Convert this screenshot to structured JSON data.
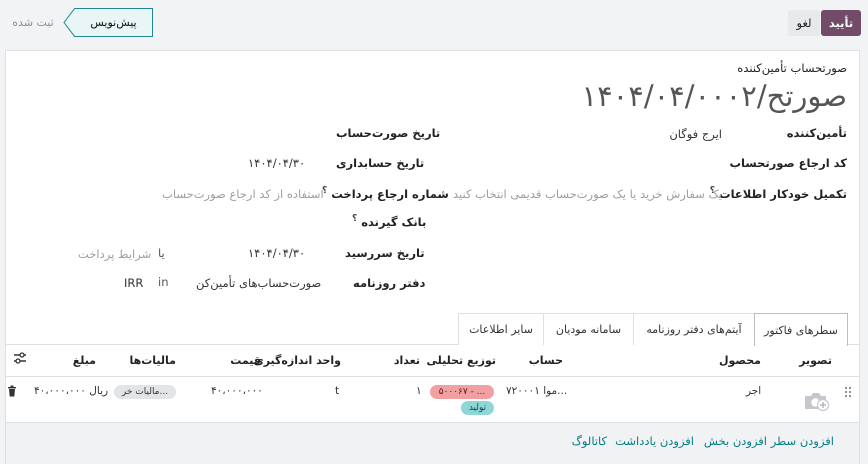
{
  "header": {
    "confirm_label": "تأیید",
    "cancel_label": "لغو",
    "status_current": "پیش‌نویس",
    "status_next": "ثبت شده"
  },
  "form": {
    "doc_type": "صورتحساب تأمین‌کننده",
    "title": "صورتح/۱۴۰۴/۰۴/۰۰۰۲",
    "vendor_label": "تأمین‌کننده",
    "vendor_value": "ایرج فوگان",
    "bill_ref_label": "کد ارجاع صورتحساب",
    "autocomplete_label": "تکمیل خودکار اطلاعات",
    "autocomplete_placeholder": "یک سفارش خرید یا یک صورت‌حساب قدیمی انتخاب کنید",
    "bill_date_label": "تاریخ صورت‌حساب",
    "accounting_date_label": "تاریخ حسابداری",
    "accounting_date_value": "۱۴۰۴/۰۴/۳۰",
    "payment_ref_label": "شماره ارجاع پرداخت",
    "payment_ref_placeholder": "استفاده از کد ارجاع صورت‌حساب",
    "bank_label": "بانک گیرنده",
    "due_date_label": "تاریخ سررسید",
    "due_date_value": "۱۴۰۴/۰۴/۳۰",
    "or_label": "یا",
    "payment_terms_placeholder": "شرایط پرداخت",
    "journal_label": "دفتر روزنامه",
    "journal_value": "صورت‌حساب‌های تأمین‌کن",
    "in_label": "in",
    "currency_value": "IRR",
    "help_mark": "؟"
  },
  "tabs": [
    {
      "label": "سطرهای فاکتور"
    },
    {
      "label": "آیتم‌های دفتر روزنامه"
    },
    {
      "label": "سامانه مودیان"
    },
    {
      "label": "سایر اطلاعات"
    }
  ],
  "table": {
    "columns": {
      "image": "تصویر",
      "product": "محصول",
      "account": "حساب",
      "analytic": "توزیع تحلیلی",
      "quantity": "تعداد",
      "uom": "واحد اندازه‌گیری",
      "price": "قیمت",
      "taxes": "مالیات‌ها",
      "amount": "مبلغ"
    },
    "rows": [
      {
        "product": "اجر",
        "account": "۷۲۰۰۰۱ موا...",
        "analytic_tag": "۵۰۰۰۶۷ - ...",
        "analytic_tag2": "تولید",
        "quantity": "۱",
        "uom": "t",
        "price": "۴۰،۰۰۰،۰۰۰",
        "taxes": "مالیات خر...",
        "amount": "۴۰،۰۰۰،۰۰۰ ریال"
      }
    ]
  },
  "footer": {
    "add_line": "افزودن سطر",
    "add_section": "افزودن بخش",
    "add_note": "افزودن یادداشت",
    "catalog": "کاتالوگ"
  },
  "colors": {
    "primary": "#714b67",
    "link": "#017e84",
    "analytic_red": "#f0a0a0",
    "analytic_teal": "#8fd6d8"
  }
}
